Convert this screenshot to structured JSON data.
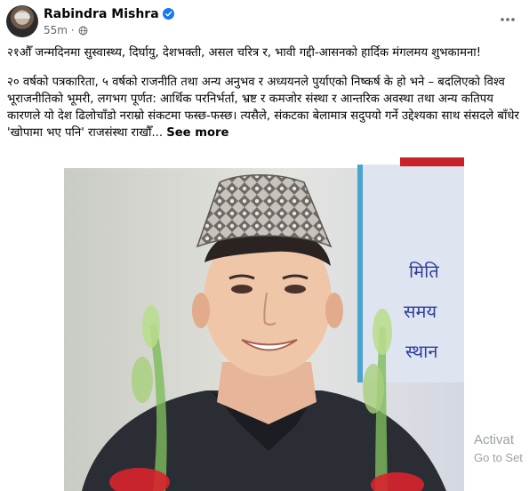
{
  "post": {
    "author": "Rabindra Mishra",
    "timestamp": "55m",
    "paragraph1": "२१औँ जन्मदिनमा सुस्वास्थ्य, दिर्घायु, देशभक्ती, असल चरित्र र, भावी गद्दी-आसनको हार्दिक मंगलमय शुभकामना!",
    "paragraph2": "२० वर्षको पत्रकारिता, ५ वर्षको राजनीति तथा अन्य अनुभव र अध्ययनले पुर्याएको निष्कर्ष के हो भने – बदलिएको विश्व भूराजनीतिको भूमरी, लगभग पूर्णत: आर्थिक परनिर्भर्ता, भ्रष्ट र कमजोर संस्था र आन्तरिक अवस्था तथा अन्य कतिपय कारणले यो देश ढिलोचाँडो नराम्रो संकटमा फस्छ-फस्छ। त्यसैले, संकटका बेलामात्र सदुपयो गर्ने उद्देश्यका साथ संसदले बाँधेर 'खोपामा भए पनि' राजसंस्था राखौँ...",
    "see_more": "See more",
    "photo_sign_lines": [
      "मिति",
      "समय",
      "स्थान"
    ]
  },
  "overlay": {
    "line1": "Activat",
    "line2": "Go to Set"
  },
  "icons": {
    "verified": "verified-badge-icon",
    "audience": "globe-icon",
    "more": "more-options-icon"
  },
  "colors": {
    "verified": "#1877f2",
    "meta": "#65676b"
  }
}
